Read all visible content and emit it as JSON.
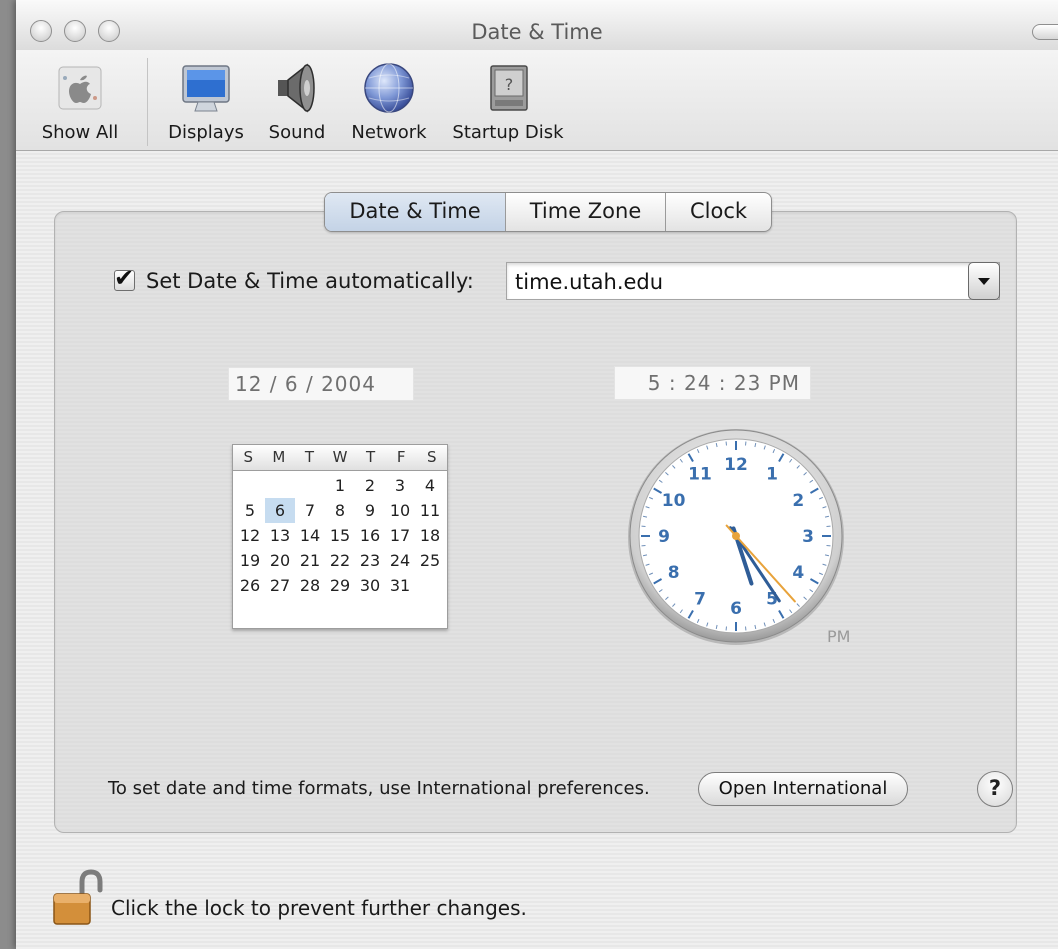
{
  "window": {
    "title": "Date & Time"
  },
  "toolbar": {
    "items": [
      {
        "label": "Show All",
        "icon": "apple-logo-icon"
      },
      {
        "label": "Displays",
        "icon": "display-icon"
      },
      {
        "label": "Sound",
        "icon": "speaker-icon"
      },
      {
        "label": "Network",
        "icon": "globe-icon"
      },
      {
        "label": "Startup Disk",
        "icon": "disk-icon"
      }
    ]
  },
  "tabs": [
    {
      "label": "Date & Time",
      "selected": true
    },
    {
      "label": "Time Zone",
      "selected": false
    },
    {
      "label": "Clock",
      "selected": false
    }
  ],
  "auto_time": {
    "checked": true,
    "label": "Set Date & Time automatically:",
    "server": "time.utah.edu"
  },
  "date_field": "12 /  6  / 2004",
  "time_field": "5 : 24 : 23 PM",
  "calendar": {
    "weekdays": [
      "S",
      "M",
      "T",
      "W",
      "T",
      "F",
      "S"
    ],
    "weeks": [
      [
        "",
        "",
        "",
        "1",
        "2",
        "3",
        "4"
      ],
      [
        "5",
        "6",
        "7",
        "8",
        "9",
        "10",
        "11"
      ],
      [
        "12",
        "13",
        "14",
        "15",
        "16",
        "17",
        "18"
      ],
      [
        "19",
        "20",
        "21",
        "22",
        "23",
        "24",
        "25"
      ],
      [
        "26",
        "27",
        "28",
        "29",
        "30",
        "31",
        ""
      ]
    ],
    "selected_day": "6"
  },
  "clock": {
    "hour": 5,
    "minute": 24,
    "second": 23,
    "period": "PM",
    "numbers": [
      "12",
      "1",
      "2",
      "3",
      "4",
      "5",
      "6",
      "7",
      "8",
      "9",
      "10",
      "11"
    ],
    "number_color": "#3a6fae",
    "second_hand_color": "#e8a33b"
  },
  "footer": {
    "note": "To set date and time formats, use International preferences.",
    "open_button": "Open International",
    "help_label": "?",
    "lock_text": "Click the lock to prevent further changes."
  }
}
